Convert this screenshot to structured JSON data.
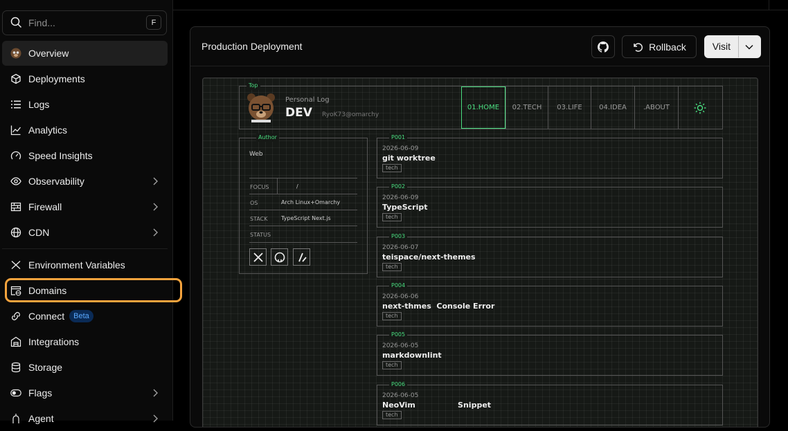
{
  "sidebar": {
    "search_placeholder": "Find...",
    "search_shortcut": "F",
    "items": [
      {
        "label": "Overview"
      },
      {
        "label": "Deployments"
      },
      {
        "label": "Logs"
      },
      {
        "label": "Analytics"
      },
      {
        "label": "Speed Insights"
      },
      {
        "label": "Observability"
      },
      {
        "label": "Firewall"
      },
      {
        "label": "CDN"
      },
      {
        "label": "Environment Variables"
      },
      {
        "label": "Domains"
      },
      {
        "label": "Connect",
        "badge": "Beta"
      },
      {
        "label": "Integrations"
      },
      {
        "label": "Storage"
      },
      {
        "label": "Flags"
      },
      {
        "label": "Agent"
      }
    ]
  },
  "card": {
    "title": "Production Deployment",
    "rollback_label": "Rollback",
    "visit_label": "Visit"
  },
  "site": {
    "frame_top_label": "Top",
    "subtitle": "Personal Log",
    "brand": "DEV",
    "handle": "RyoK73@omarchy",
    "nav": [
      "01.HOME",
      "02.TECH",
      "03.LIFE",
      "04.IDEA",
      ".ABOUT"
    ],
    "author_label": "Author",
    "author_role": "Web",
    "author_rows": [
      {
        "key": "FOCUS",
        "value": "/"
      },
      {
        "key": "OS",
        "value": "Arch Linux+Omarchy"
      },
      {
        "key": "STACK",
        "value": "TypeScript  Next.js"
      },
      {
        "key": "STATUS",
        "value": ""
      }
    ],
    "posts": [
      {
        "id": "P001",
        "date": "2026-06-09",
        "title": "git worktree",
        "tag": "tech"
      },
      {
        "id": "P002",
        "date": "2026-06-09",
        "title": "TypeScript",
        "tag": "tech"
      },
      {
        "id": "P003",
        "date": "2026-06-07",
        "title": "teispace/next-themes",
        "tag": "tech"
      },
      {
        "id": "P004",
        "date": "2026-06-06",
        "title": "next-thmes  Console Error",
        "tag": "tech"
      },
      {
        "id": "P005",
        "date": "2026-06-05",
        "title": "markdownlint",
        "tag": "tech"
      },
      {
        "id": "P006",
        "date": "2026-06-05",
        "title": "NeoVim                Snippet",
        "tag": "tech"
      }
    ]
  },
  "colors": {
    "accent_green": "#4ade80",
    "highlight_orange": "#f5a33d",
    "beta_blue": "#5aa9ff"
  }
}
